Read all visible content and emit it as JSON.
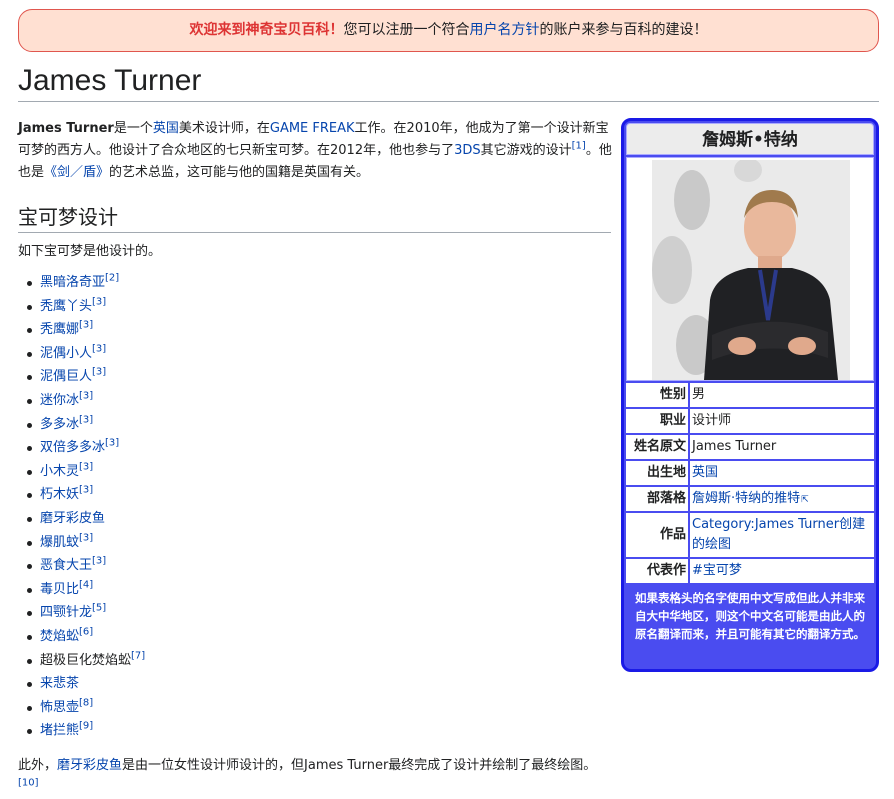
{
  "notice": {
    "welcome": "欢迎来到神奇宝贝百科！",
    "text_before": "您可以注册一个符合",
    "link": "用户名方针",
    "text_after": "的账户来参与百科的建设！"
  },
  "page_title": "James Turner",
  "intro": {
    "name": "James Turner",
    "t1": "是一个",
    "l_uk": "英国",
    "t2": "美术设计师，在",
    "l_gf": "GAME FREAK",
    "t3": "工作。在2010年，他成为了第一个设计新宝可梦的西方人。他设计了合众地区的七只新宝可梦。在2012年，他也参与了",
    "l_3ds": "3DS",
    "t4": "其它游戏的设计",
    "ref1": "[1]",
    "t5": "。他也是",
    "l_sword": "《剑／盾》",
    "t6": "的艺术总监，这可能与他的国籍是英国有关。"
  },
  "section": {
    "heading": "宝可梦设计",
    "lead": "如下宝可梦是他设计的。",
    "items": [
      {
        "name": "黑暗洛奇亚",
        "ref": "[2]"
      },
      {
        "name": "秃鹰丫头",
        "ref": "[3]"
      },
      {
        "name": "秃鹰娜",
        "ref": "[3]"
      },
      {
        "name": "泥偶小人",
        "ref": "[3]"
      },
      {
        "name": "泥偶巨人",
        "ref": "[3]"
      },
      {
        "name": "迷你冰",
        "ref": "[3]"
      },
      {
        "name": "多多冰",
        "ref": "[3]"
      },
      {
        "name": "双倍多多冰",
        "ref": "[3]"
      },
      {
        "name": "小木灵",
        "ref": "[3]"
      },
      {
        "name": "朽木妖",
        "ref": "[3]"
      },
      {
        "name": "磨牙彩皮鱼",
        "ref": ""
      },
      {
        "name": "爆肌蚊",
        "ref": "[3]"
      },
      {
        "name": "恶食大王",
        "ref": "[3]"
      },
      {
        "name": "毒贝比",
        "ref": "[4]"
      },
      {
        "name": "四颚针龙",
        "ref": "[5]"
      },
      {
        "name": "焚焰蚣",
        "ref": "[6]"
      },
      {
        "name": "超极巨化焚焰蚣",
        "ref": "[7]"
      },
      {
        "name": "来悲茶",
        "ref": ""
      },
      {
        "name": "怖思壶",
        "ref": "[8]"
      },
      {
        "name": "堵拦熊",
        "ref": "[9]"
      }
    ],
    "footnote": {
      "t1": "此外，",
      "link": "磨牙彩皮鱼",
      "t2": "是由一位女性设计师设计的，但James Turner最终完成了设计并绘制了最终绘图。",
      "ref": "[10]"
    }
  },
  "infobox": {
    "title": "詹姆斯•特纳",
    "rows": {
      "gender_k": "性别",
      "gender_v": "男",
      "job_k": "职业",
      "job_v": "设计师",
      "orig_k": "姓名原文",
      "orig_v": "James Turner",
      "birth_k": "出生地",
      "birth_v": "英国",
      "blog_k": "部落格",
      "blog_v": "詹姆斯·特纳的推特",
      "works_k": "作品",
      "works_v": "Category:James Turner创建的绘图",
      "rep_k": "代表作",
      "rep_v": "#宝可梦"
    },
    "note": "如果表格头的名字使用中文写成但此人并非来自大中华地区，则这个中文名可能是由此人的原名翻译而来，并且可能有其它的翻译方式。"
  },
  "colors": {
    "link": "#0645ad",
    "notice_bg": "#ffe0d2",
    "notice_border": "#e0564e",
    "welcome": "#d33333",
    "infobox_bg": "#4a4cf0",
    "infobox_border": "#1a1ae6"
  }
}
